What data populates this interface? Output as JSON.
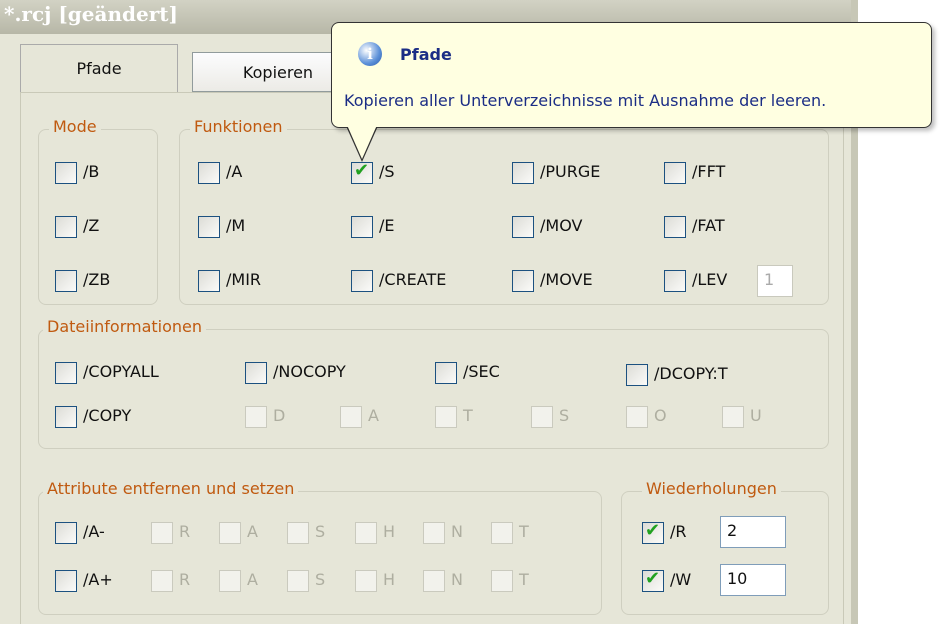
{
  "window": {
    "title": "*.rcj [geändert]"
  },
  "tabs": [
    {
      "label": "Pfade"
    },
    {
      "label": "Kopieren"
    }
  ],
  "tooltip": {
    "title": "Pfade",
    "text": "Kopieren aller Unterverzeichnisse mit Ausnahme der leeren.",
    "icon": "info-icon"
  },
  "mode": {
    "legend": "Mode",
    "items": [
      {
        "label": "/B"
      },
      {
        "label": "/Z"
      },
      {
        "label": "/ZB"
      }
    ]
  },
  "funktionen": {
    "legend": "Funktionen",
    "items": [
      {
        "label": "/A",
        "checked": false
      },
      {
        "label": "/S",
        "checked": true
      },
      {
        "label": "/PURGE",
        "checked": false
      },
      {
        "label": "/FFT",
        "checked": false
      },
      {
        "label": "/M",
        "checked": false
      },
      {
        "label": "/E",
        "checked": false
      },
      {
        "label": "/MOV",
        "checked": false
      },
      {
        "label": "/FAT",
        "checked": false
      },
      {
        "label": "/MIR",
        "checked": false
      },
      {
        "label": "/CREATE",
        "checked": false
      },
      {
        "label": "/MOVE",
        "checked": false
      },
      {
        "label": "/LEV",
        "checked": false
      }
    ],
    "lev_value": "1"
  },
  "dateiinfo": {
    "legend": "Dateiinformationen",
    "row1": [
      "/COPYALL",
      "/NOCOPY",
      "/SEC",
      "/DCOPY:T"
    ],
    "copy_label": "/COPY",
    "copy_flags": [
      "D",
      "A",
      "T",
      "S",
      "O",
      "U"
    ]
  },
  "attribute": {
    "legend": "Attribute entfernen und setzen",
    "minus_label": "/A-",
    "plus_label": "/A+",
    "flags": [
      "R",
      "A",
      "S",
      "H",
      "N",
      "T"
    ]
  },
  "wiederholungen": {
    "legend": "Wiederholungen",
    "r_label": "/R",
    "r_value": "2",
    "w_label": "/W",
    "w_value": "10",
    "r_checked": true,
    "w_checked": true
  }
}
